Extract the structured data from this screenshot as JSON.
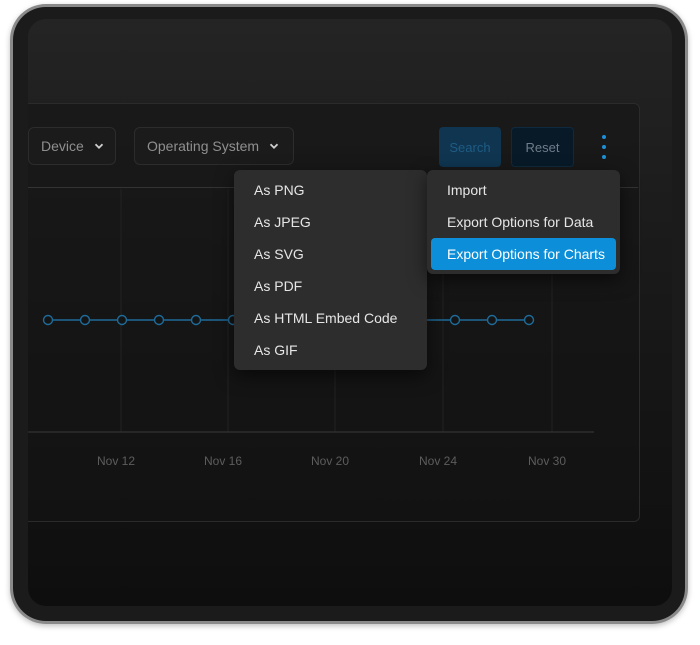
{
  "filters": [
    {
      "label": "Device"
    },
    {
      "label": "Operating System"
    }
  ],
  "buttons": {
    "search": "Search",
    "reset": "Reset"
  },
  "icons": {
    "more": "more-vertical-icon",
    "chevron": "chevron-down-icon"
  },
  "colors": {
    "accent": "#0c8fd8",
    "line": "#1e6b9a"
  },
  "export_menu": {
    "items": [
      {
        "label": "Import"
      },
      {
        "label": "Export Options for Data"
      },
      {
        "label": "Export Options for Charts"
      }
    ],
    "active_index": 2
  },
  "chart_submenu": {
    "items": [
      {
        "label": "As PNG"
      },
      {
        "label": "As JPEG"
      },
      {
        "label": "As SVG"
      },
      {
        "label": "As PDF"
      },
      {
        "label": "As HTML Embed Code"
      },
      {
        "label": "As GIF"
      }
    ]
  },
  "chart_data": {
    "type": "line",
    "x_tick_labels": [
      "Nov 12",
      "Nov 16",
      "Nov 20",
      "Nov 24",
      "Nov 30"
    ],
    "grid": true,
    "series": [
      {
        "color": "#1e6b9a",
        "points_visible": 14
      }
    ]
  }
}
